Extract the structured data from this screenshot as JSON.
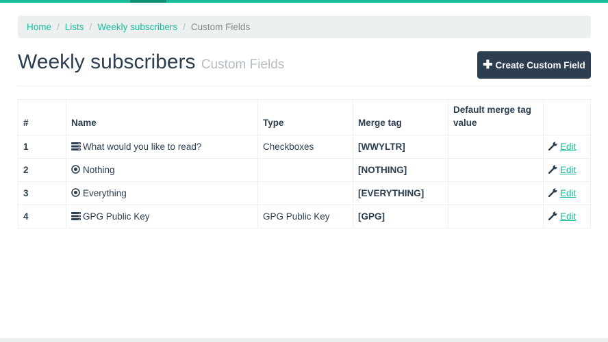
{
  "breadcrumb": {
    "items": [
      "Home",
      "Lists",
      "Weekly subscribers"
    ],
    "current": "Custom Fields"
  },
  "header": {
    "title": "Weekly subscribers",
    "subtitle": "Custom Fields",
    "create_button": "Create Custom Field"
  },
  "table": {
    "columns": [
      "#",
      "Name",
      "Type",
      "Merge tag",
      "Default merge tag value",
      ""
    ],
    "rows": [
      {
        "num": "1",
        "icon": "list-icon",
        "name": "What would you like to read?",
        "type": "Checkboxes",
        "merge_tag": "[WWYLTR]",
        "default": "",
        "action": "Edit"
      },
      {
        "num": "2",
        "icon": "radio-icon",
        "name": "Nothing",
        "type": "",
        "merge_tag": "[NOTHING]",
        "default": "",
        "action": "Edit"
      },
      {
        "num": "3",
        "icon": "radio-icon",
        "name": "Everything",
        "type": "",
        "merge_tag": "[EVERYTHING]",
        "default": "",
        "action": "Edit"
      },
      {
        "num": "4",
        "icon": "list-icon",
        "name": "GPG Public Key",
        "type": "GPG Public Key",
        "merge_tag": "[GPG]",
        "default": "",
        "action": "Edit"
      }
    ]
  },
  "colors": {
    "accent": "#18bc9c",
    "primary": "#2c3e50"
  }
}
